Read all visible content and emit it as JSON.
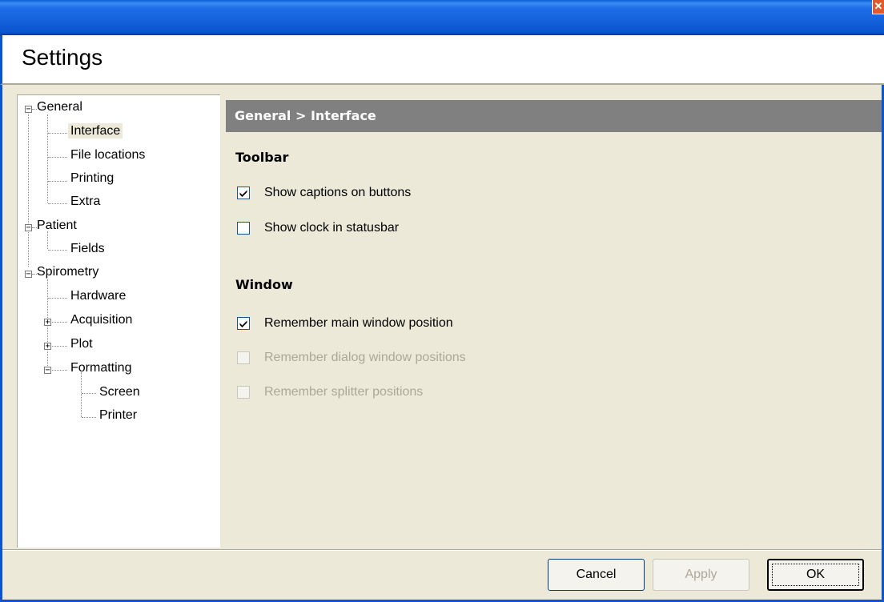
{
  "window": {
    "close_glyph": "✕"
  },
  "dialog": {
    "title": "Settings"
  },
  "tree": [
    {
      "label": "General",
      "expander": "−"
    },
    {
      "label": "Interface",
      "selected": true
    },
    {
      "label": "File locations"
    },
    {
      "label": "Printing"
    },
    {
      "label": "Extra"
    },
    {
      "label": "Patient",
      "expander": "−"
    },
    {
      "label": "Fields"
    },
    {
      "label": "Spirometry",
      "expander": "−"
    },
    {
      "label": "Hardware"
    },
    {
      "label": "Acquisition",
      "expander": "+"
    },
    {
      "label": "Plot",
      "expander": "+"
    },
    {
      "label": "Formatting",
      "expander": "−"
    },
    {
      "label": "Screen"
    },
    {
      "label": "Printer"
    }
  ],
  "content": {
    "breadcrumb": "General > Interface",
    "sections": [
      {
        "title": "Toolbar",
        "options": [
          {
            "label": "Show captions on buttons",
            "checked": true,
            "enabled": true
          },
          {
            "label": "Show clock in statusbar",
            "checked": false,
            "enabled": true
          }
        ]
      },
      {
        "title": "Window",
        "options": [
          {
            "label": "Remember main window position",
            "checked": true,
            "enabled": true
          },
          {
            "label": "Remember dialog window positions",
            "checked": false,
            "enabled": false
          },
          {
            "label": "Remember splitter positions",
            "checked": false,
            "enabled": false
          }
        ]
      }
    ]
  },
  "buttons": {
    "cancel": "Cancel",
    "apply": "Apply",
    "ok": "OK"
  },
  "colors": {
    "titlebar": "#0a55d0",
    "face": "#ece9d8",
    "header_bar": "#808080"
  }
}
